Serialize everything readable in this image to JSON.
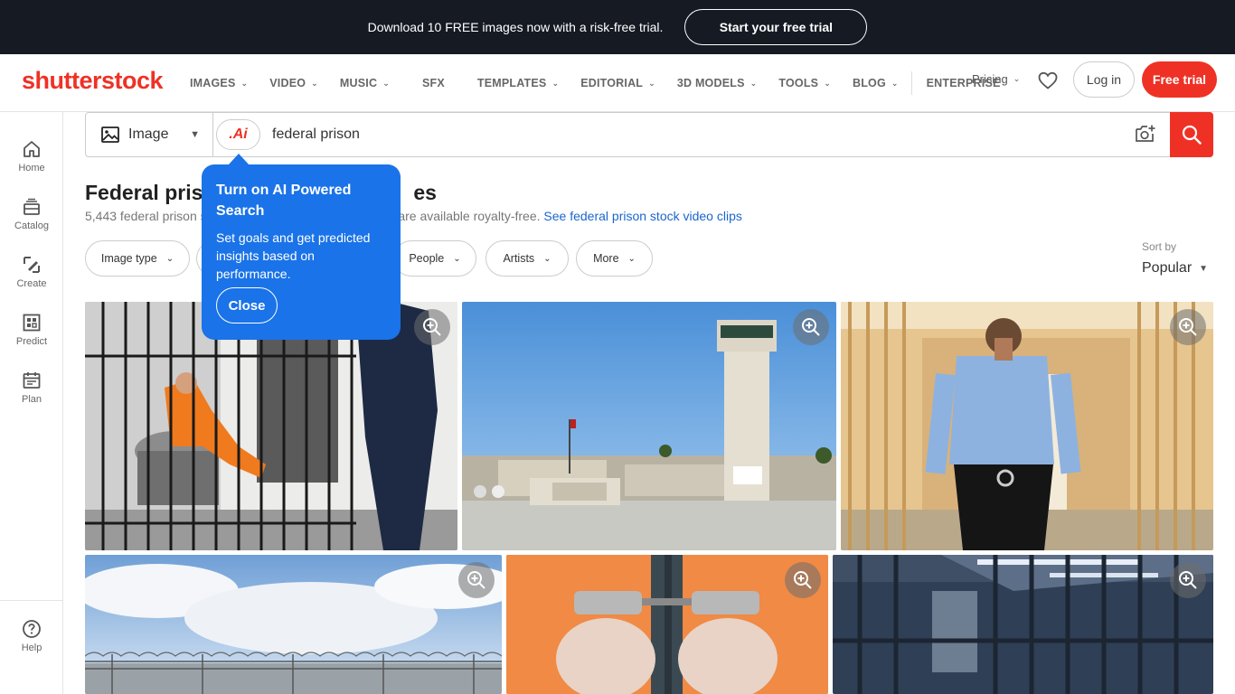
{
  "promo": {
    "text": "Download 10 FREE images now with a risk-free trial.",
    "cta": "Start your free trial"
  },
  "header": {
    "logo": "shutterstock",
    "nav": [
      {
        "label": "IMAGES",
        "dropdown": true
      },
      {
        "label": "VIDEO",
        "dropdown": true
      },
      {
        "label": "MUSIC",
        "dropdown": true
      },
      {
        "label": "SFX",
        "dropdown": false
      },
      {
        "label": "TEMPLATES",
        "dropdown": true
      },
      {
        "label": "EDITORIAL",
        "dropdown": true
      },
      {
        "label": "3D MODELS",
        "dropdown": true
      },
      {
        "label": "TOOLS",
        "dropdown": true
      },
      {
        "label": "BLOG",
        "dropdown": true
      },
      {
        "label": "ENTERPRISE",
        "dropdown": false
      }
    ],
    "pricing": "Pricing",
    "login": "Log in",
    "free_trial": "Free trial",
    "brand_color": "#ef3125"
  },
  "sidebar": {
    "items": [
      {
        "label": "Home",
        "icon": "home-icon"
      },
      {
        "label": "Catalog",
        "icon": "catalog-icon"
      },
      {
        "label": "Create",
        "icon": "create-icon"
      },
      {
        "label": "Predict",
        "icon": "predict-icon"
      },
      {
        "label": "Plan",
        "icon": "plan-icon"
      }
    ],
    "help": "Help"
  },
  "search": {
    "type_label": "Image",
    "ai_label": ".Ai",
    "query": "federal prison"
  },
  "results": {
    "title_start": "Federal pris",
    "title_end": "es",
    "subtitle_start": "5,443 federal prison s",
    "subtitle_end": "ns are available royalty-free.",
    "video_link": "See federal prison stock video clips"
  },
  "filters": [
    "Image type",
    "People",
    "Artists",
    "More"
  ],
  "sort": {
    "label": "Sort by",
    "value": "Popular"
  },
  "tooltip": {
    "title": "Turn on AI Powered Search",
    "body": "Set goals and get predicted insights based on performance.",
    "close": "Close",
    "color": "#1a73e8"
  },
  "images": [
    {
      "subject": "inmate in orange jumpsuit in cell with guard"
    },
    {
      "subject": "federal correctional institution watchtower"
    },
    {
      "subject": "prison guard walking through cell block"
    },
    {
      "subject": "prison fence with razor wire under cloudy sky"
    },
    {
      "subject": "handcuffed hands in orange jumpsuit"
    },
    {
      "subject": "empty prison cell bars"
    }
  ]
}
